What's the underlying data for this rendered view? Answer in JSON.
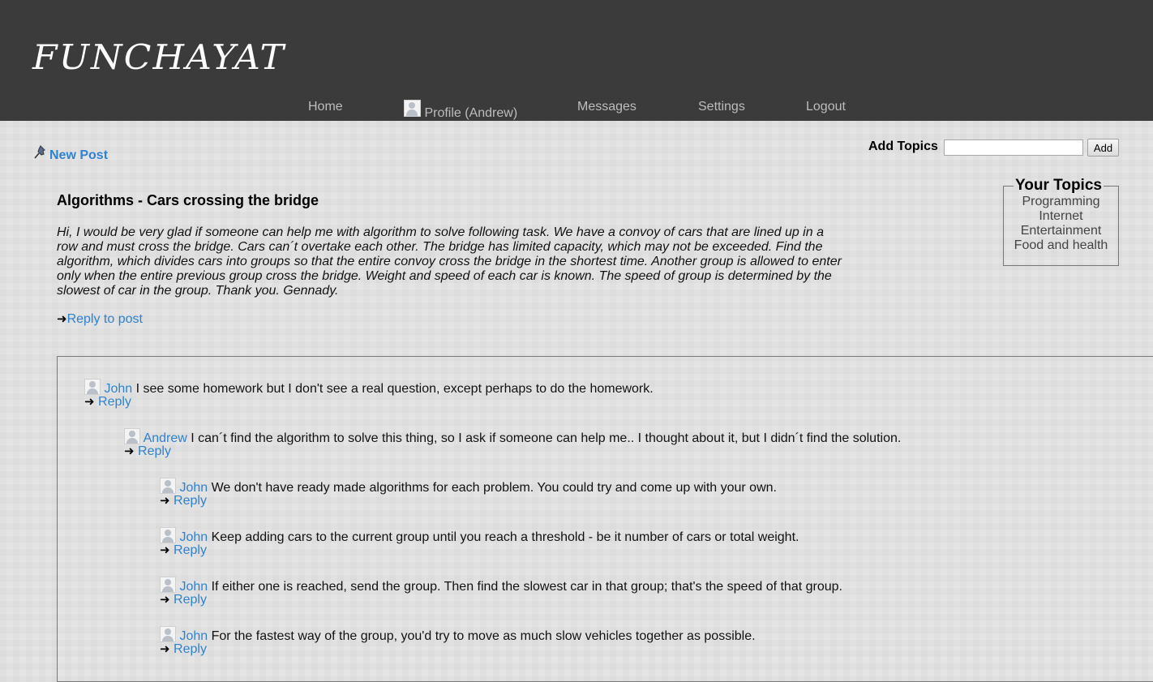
{
  "header": {
    "logo": "FUNCHAYAT",
    "nav": {
      "home": "Home",
      "profile": "Profile (Andrew)",
      "messages": "Messages",
      "settings": "Settings",
      "logout": "Logout"
    }
  },
  "toolbar": {
    "new_post": "New Post",
    "add_topics_label": "Add Topics",
    "topic_input_value": "",
    "add_button": "Add"
  },
  "topics": {
    "legend": "Your Topics",
    "items": [
      "Programming",
      "Internet",
      "Entertainment",
      "Food and health"
    ]
  },
  "post": {
    "title": "Algorithms - Cars crossing the bridge",
    "body": "Hi, I would be very glad if someone can help me with algorithm to solve following task. We have a convoy of cars that are lined up in a row and must cross the bridge. Cars can´t overtake each other. The bridge has limited capacity, which may not be exceeded. Find the algorithm, which divides cars into groups so that the entire convoy cross the bridge in the shortest time. Another group is allowed to enter only when the entire previous group cross the bridge. Weight and speed of each car is known. The speed of group is determined by the slowest of car in the group. Thank you. Gennady.",
    "reply_label": "Reply to post"
  },
  "comments": [
    {
      "author": "John",
      "text": "I see some homework but I don't see a real question, except perhaps to do the homework.",
      "reply": "Reply"
    },
    {
      "author": "Andrew",
      "text": "I can´t find the algorithm to solve this thing, so I ask if someone can help me.. I thought about it, but I didn´t find the solution.",
      "reply": "Reply"
    },
    {
      "author": "John",
      "text": "We don't have ready made algorithms for each problem. You could try and come up with your own.",
      "reply": "Reply"
    },
    {
      "author": "John",
      "text": "Keep adding cars to the current group until you reach a threshold - be it number of cars or total weight.",
      "reply": "Reply"
    },
    {
      "author": "John",
      "text": "If either one is reached, send the group. Then find the slowest car in that group; that's the speed of that group.",
      "reply": "Reply"
    },
    {
      "author": "John",
      "text": "For the fastest way of the group, you'd try to move as much slow vehicles together as possible.",
      "reply": "Reply"
    }
  ]
}
